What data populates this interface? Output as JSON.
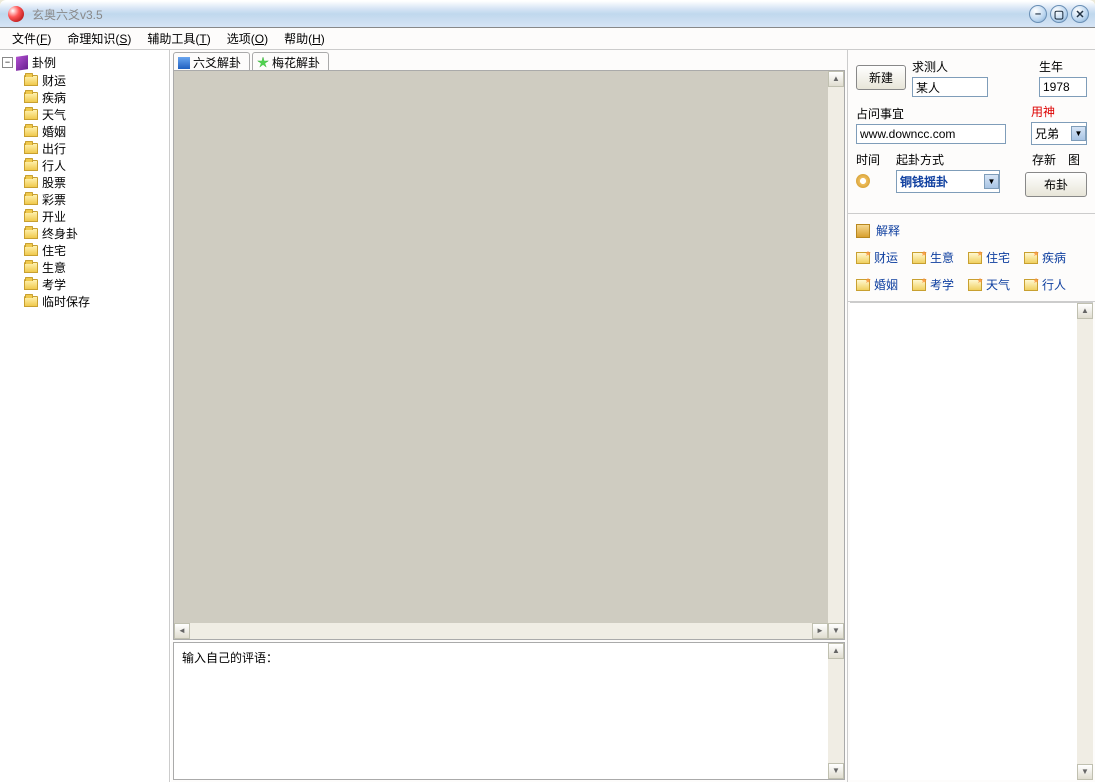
{
  "titlebar": {
    "title": "玄奥六爻v3.5"
  },
  "menu": [
    {
      "label": "文件",
      "key": "F"
    },
    {
      "label": "命理知识",
      "key": "S"
    },
    {
      "label": "辅助工具",
      "key": "T"
    },
    {
      "label": "选项",
      "key": "O"
    },
    {
      "label": "帮助",
      "key": "H"
    }
  ],
  "tree": {
    "root": "卦例",
    "items": [
      "财运",
      "疾病",
      "天气",
      "婚姻",
      "出行",
      "行人",
      "股票",
      "彩票",
      "开业",
      "终身卦",
      "住宅",
      "生意",
      "考学",
      "临时保存"
    ]
  },
  "tabs": [
    {
      "label": "六爻解卦"
    },
    {
      "label": "梅花解卦"
    }
  ],
  "comment_label": "输入自己的评语：",
  "right": {
    "new_btn": "新建",
    "person_label": "求测人",
    "person_value": "某人",
    "year_label": "生年",
    "year_value": "1978",
    "matter_label": "占问事宜",
    "matter_value": "www.downcc.com",
    "yongshen_label": "用神",
    "yongshen_value": "兄弟",
    "time_label": "时间",
    "method_label": "起卦方式",
    "method_value": "铜钱摇卦",
    "cunxin": "存新",
    "tu": "图",
    "bugua_btn": "布卦",
    "explain": "解释",
    "links": [
      "财运",
      "生意",
      "住宅",
      "疾病",
      "婚姻",
      "考学",
      "天气",
      "行人"
    ]
  }
}
